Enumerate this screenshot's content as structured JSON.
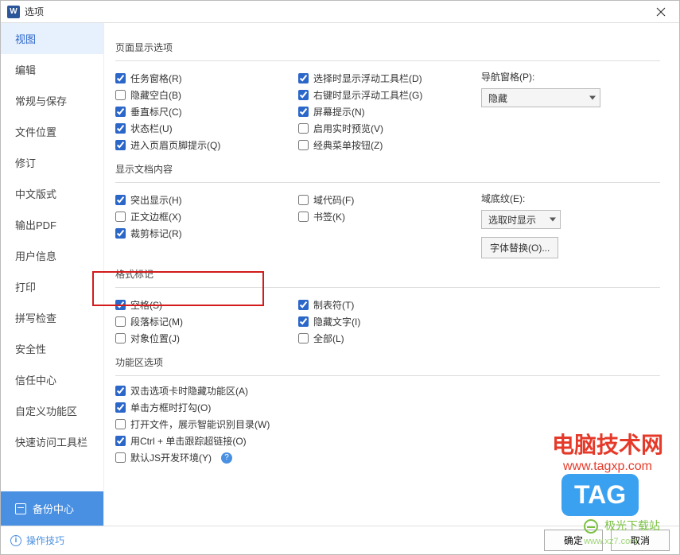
{
  "title": "选项",
  "sidebar": {
    "items": [
      {
        "label": "视图"
      },
      {
        "label": "编辑"
      },
      {
        "label": "常规与保存"
      },
      {
        "label": "文件位置"
      },
      {
        "label": "修订"
      },
      {
        "label": "中文版式"
      },
      {
        "label": "输出PDF"
      },
      {
        "label": "用户信息"
      },
      {
        "label": "打印"
      },
      {
        "label": "拼写检查"
      },
      {
        "label": "安全性"
      },
      {
        "label": "信任中心"
      },
      {
        "label": "自定义功能区"
      },
      {
        "label": "快速访问工具栏"
      }
    ],
    "backup_label": "备份中心"
  },
  "sections": {
    "page_display": {
      "title": "页面显示选项",
      "col1": [
        {
          "label": "任务窗格(R)",
          "checked": true
        },
        {
          "label": "隐藏空白(B)",
          "checked": false
        },
        {
          "label": "垂直标尺(C)",
          "checked": true
        },
        {
          "label": "状态栏(U)",
          "checked": true
        },
        {
          "label": "进入页眉页脚提示(Q)",
          "checked": true
        }
      ],
      "col2": [
        {
          "label": "选择时显示浮动工具栏(D)",
          "checked": true
        },
        {
          "label": "右键时显示浮动工具栏(G)",
          "checked": true
        },
        {
          "label": "屏幕提示(N)",
          "checked": true
        },
        {
          "label": "启用实时预览(V)",
          "checked": false
        },
        {
          "label": "经典菜单按钮(Z)",
          "checked": false
        }
      ],
      "nav_label": "导航窗格(P):",
      "nav_value": "隐藏"
    },
    "doc_content": {
      "title": "显示文档内容",
      "col1": [
        {
          "label": "突出显示(H)",
          "checked": true
        },
        {
          "label": "正文边框(X)",
          "checked": false
        },
        {
          "label": "裁剪标记(R)",
          "checked": true
        }
      ],
      "col2": [
        {
          "label": "域代码(F)",
          "checked": false
        },
        {
          "label": "书签(K)",
          "checked": false
        }
      ],
      "shading_label": "域底纹(E):",
      "shading_value": "选取时显示",
      "font_sub_btn": "字体替换(O)..."
    },
    "format_marks": {
      "title": "格式标记",
      "col1": [
        {
          "label": "空格(S)",
          "checked": true
        },
        {
          "label": "段落标记(M)",
          "checked": false
        },
        {
          "label": "对象位置(J)",
          "checked": false
        }
      ],
      "col2": [
        {
          "label": "制表符(T)",
          "checked": true
        },
        {
          "label": "隐藏文字(I)",
          "checked": true
        },
        {
          "label": "全部(L)",
          "checked": false
        }
      ]
    },
    "ribbon_opts": {
      "title": "功能区选项",
      "items": [
        {
          "label": "双击选项卡时隐藏功能区(A)",
          "checked": true
        },
        {
          "label": "单击方框时打勾(O)",
          "checked": true
        },
        {
          "label": "打开文件，展示智能识别目录(W)",
          "checked": false
        },
        {
          "label": "用Ctrl + 单击跟踪超链接(O)",
          "checked": true
        },
        {
          "label": "默认JS开发环境(Y)",
          "checked": false,
          "help": true
        }
      ]
    }
  },
  "footer": {
    "tips": "操作技巧",
    "ok": "确定",
    "cancel": "取消"
  },
  "watermarks": {
    "wm1_top": "电脑技术网",
    "wm1_sub": "www.tagxp.com",
    "wm2": "TAG",
    "wm3": "极光下载站",
    "wm3_sub": "www.xz7.com"
  }
}
